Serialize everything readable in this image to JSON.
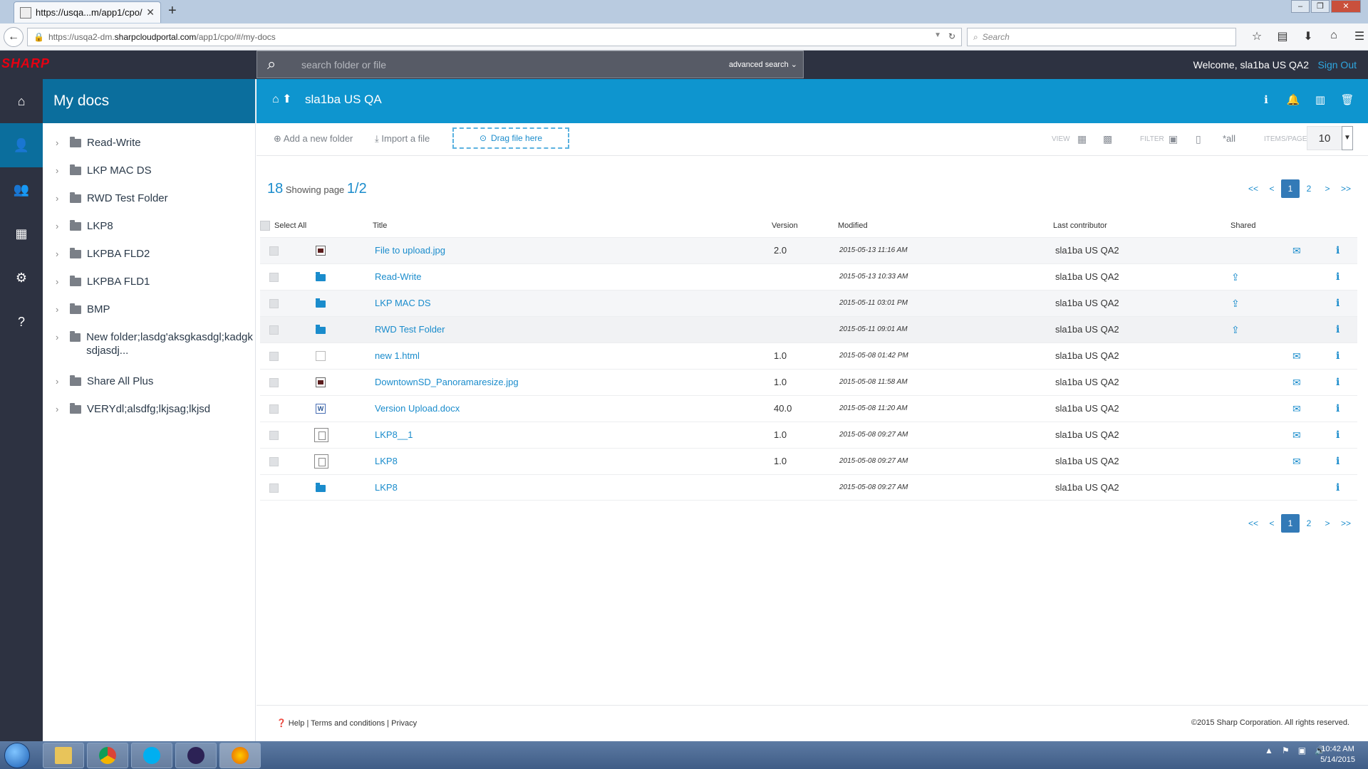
{
  "browser": {
    "tab_title": "https://usqa...m/app1/cpo/",
    "tab_close": "✕",
    "new_tab": "+",
    "url_prefix": "https://usqa2-dm.",
    "url_domain": "sharpcloudportal.com",
    "url_suffix": "/app1/cpo/#/my-docs",
    "search_placeholder": "Search"
  },
  "header": {
    "logo": "SHARP",
    "search_placeholder": "search folder or file",
    "advanced_search": "advanced search",
    "welcome": "Welcome, sla1ba US QA2",
    "sign_out": "Sign Out"
  },
  "sidebar": {
    "title": "My docs",
    "folders": [
      {
        "label": "Read-Write"
      },
      {
        "label": "LKP MAC DS"
      },
      {
        "label": "RWD Test Folder"
      },
      {
        "label": "LKP8"
      },
      {
        "label": "LKPBA FLD2"
      },
      {
        "label": "LKPBA FLD1"
      },
      {
        "label": "BMP"
      },
      {
        "label": "New folder;lasdg'aksgkasdgl;kadgksdjasdj..."
      },
      {
        "label": "Share All Plus"
      },
      {
        "label": "VERYdl;alsdfg;lkjsag;lkjsd"
      }
    ]
  },
  "breadcrumb": {
    "current": "sla1ba US QA"
  },
  "toolbar": {
    "add_folder": "Add a new folder",
    "import_file": "Import a file",
    "drag_file": "Drag file here",
    "view_label": "VIEW",
    "filter_label": "FILTER",
    "filter_all": "*all",
    "items_per_page_label": "ITEMS/PAGE",
    "items_per_page": "10"
  },
  "summary": {
    "count": "18",
    "showing_label": "Showing page",
    "page": "1/2"
  },
  "pagination": {
    "first": "<<",
    "prev": "<",
    "pages": [
      "1",
      "2"
    ],
    "next": ">",
    "last": ">>"
  },
  "table": {
    "select_all": "Select All",
    "columns": {
      "title": "Title",
      "version": "Version",
      "modified": "Modified",
      "contributor": "Last contributor",
      "shared": "Shared"
    },
    "rows": [
      {
        "type": "img",
        "title": "File to upload.jpg",
        "version": "2.0",
        "modified": "2015-05-13 11:16 AM",
        "contributor": "sla1ba US QA2",
        "shared": "",
        "mail": "✉"
      },
      {
        "type": "folder",
        "title": "Read-Write",
        "version": "",
        "modified": "2015-05-13 10:33 AM",
        "contributor": "sla1ba US QA2",
        "shared": "⇪",
        "mail": ""
      },
      {
        "type": "folder",
        "title": "LKP MAC DS",
        "version": "",
        "modified": "2015-05-11 03:01 PM",
        "contributor": "sla1ba US QA2",
        "shared": "⇪",
        "mail": ""
      },
      {
        "type": "folder",
        "title": "RWD Test Folder",
        "version": "",
        "modified": "2015-05-11 09:01 AM",
        "contributor": "sla1ba US QA2",
        "shared": "⇪",
        "mail": ""
      },
      {
        "type": "html",
        "title": "new 1.html",
        "version": "1.0",
        "modified": "2015-05-08 01:42 PM",
        "contributor": "sla1ba US QA2",
        "shared": "",
        "mail": "✉"
      },
      {
        "type": "img",
        "title": "DowntownSD_Panoramaresize.jpg",
        "version": "1.0",
        "modified": "2015-05-08 11:58 AM",
        "contributor": "sla1ba US QA2",
        "shared": "",
        "mail": "✉"
      },
      {
        "type": "docx",
        "title": "Version Upload.docx",
        "version": "40.0",
        "modified": "2015-05-08 11:20 AM",
        "contributor": "sla1ba US QA2",
        "shared": "",
        "mail": "✉"
      },
      {
        "type": "gen",
        "title": "LKP8__1",
        "version": "1.0",
        "modified": "2015-05-08 09:27 AM",
        "contributor": "sla1ba US QA2",
        "shared": "",
        "mail": "✉"
      },
      {
        "type": "gen",
        "title": "LKP8",
        "version": "1.0",
        "modified": "2015-05-08 09:27 AM",
        "contributor": "sla1ba US QA2",
        "shared": "",
        "mail": "✉"
      },
      {
        "type": "folder",
        "title": "LKP8",
        "version": "",
        "modified": "2015-05-08 09:27 AM",
        "contributor": "sla1ba US QA2",
        "shared": "",
        "mail": ""
      }
    ]
  },
  "footer": {
    "help": "Help",
    "terms": "Terms and conditions",
    "privacy": "Privacy",
    "copyright": "2015 Sharp Corporation. All rights reserved."
  },
  "taskbar": {
    "time": "10:42 AM",
    "date": "5/14/2015"
  },
  "colors": {
    "accent": "#0e95cf",
    "sidebar_header": "#0b6e9d",
    "dark": "#2d3241",
    "link": "#1a8ccc"
  }
}
